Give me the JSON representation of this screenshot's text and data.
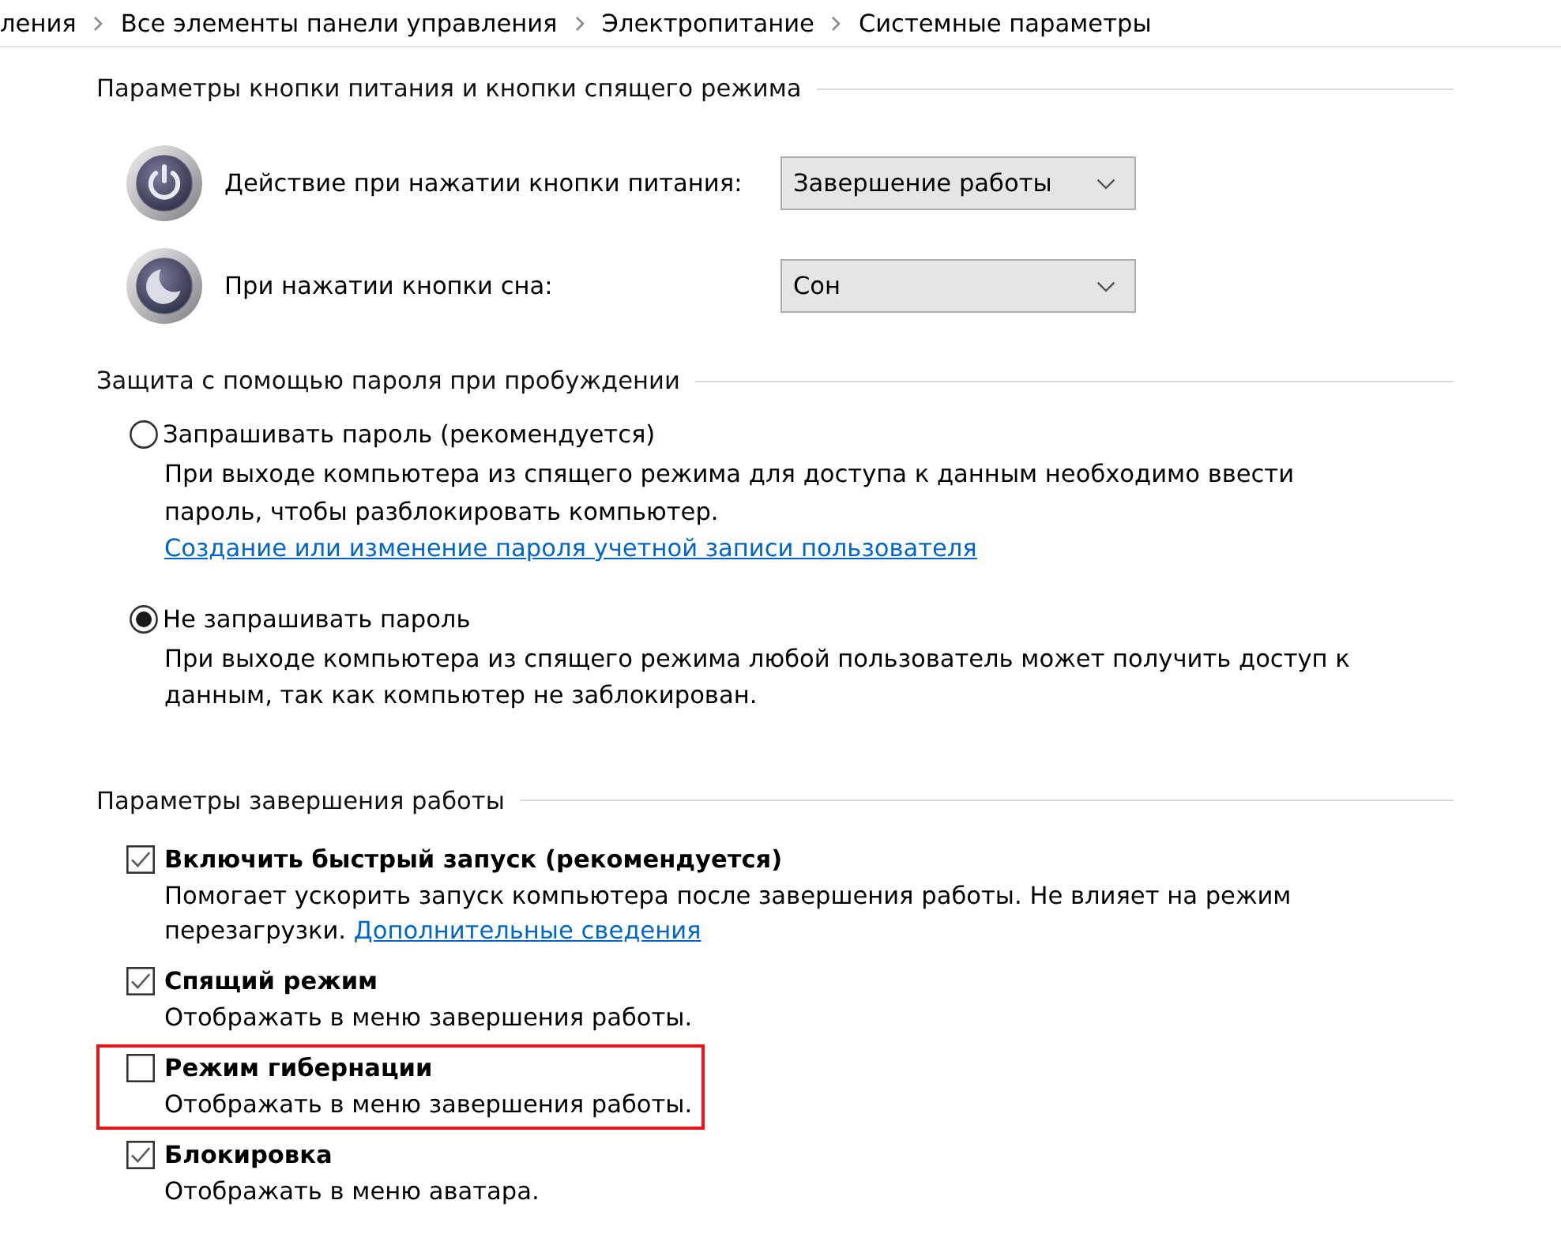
{
  "breadcrumb": [
    {
      "label": "ления"
    },
    {
      "label": "Все элементы панели управления"
    },
    {
      "label": "Электропитание"
    },
    {
      "label": "Системные параметры"
    }
  ],
  "sections": [
    {
      "kind": "buttons",
      "title": "Параметры кнопки питания и кнопки спящего режима",
      "rows": [
        {
          "kind": "power",
          "label": "Действие при нажатии кнопки питания:",
          "value": "Завершение работы"
        },
        {
          "kind": "sleep",
          "label": "При нажатии кнопки сна:",
          "value": "Сон"
        }
      ]
    },
    {
      "kind": "radios",
      "title": "Защита с помощью пароля при пробуждении",
      "options": [
        {
          "label": "Запрашивать пароль (рекомендуется)",
          "selected": false,
          "description": "При выходе компьютера из спящего режима для доступа к данным необходимо ввести пароль, чтобы разблокировать компьютер.",
          "link": "Создание или изменение пароля учетной записи пользователя"
        },
        {
          "label": "Не запрашивать пароль",
          "selected": true,
          "description": "При выходе компьютера из спящего режима любой пользователь может получить доступ к данным, так как компьютер не заблокирован."
        }
      ]
    },
    {
      "kind": "checkboxes",
      "title": "Параметры завершения работы",
      "options": [
        {
          "label": "Включить быстрый запуск (рекомендуется)",
          "checked": true,
          "highlighted": false,
          "description": "Помогает ускорить запуск компьютера после завершения работы. Не влияет на режим перезагрузки.",
          "link": "Дополнительные сведения"
        },
        {
          "label": "Спящий режим",
          "checked": true,
          "highlighted": false,
          "description": "Отображать в меню завершения работы."
        },
        {
          "label": "Режим гибернации",
          "checked": false,
          "highlighted": true,
          "description": "Отображать в меню завершения работы."
        },
        {
          "label": "Блокировка",
          "checked": true,
          "highlighted": false,
          "description": "Отображать в меню аватара."
        }
      ]
    }
  ]
}
